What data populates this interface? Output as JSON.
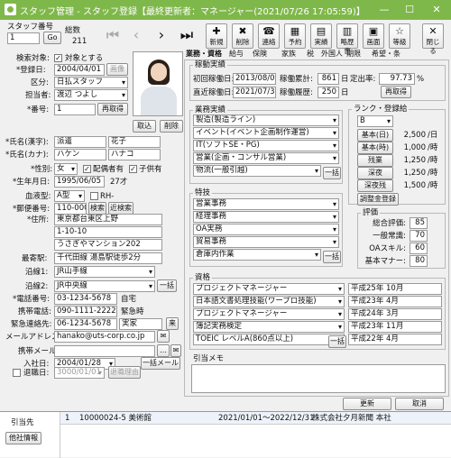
{
  "window": {
    "title": "スタッフ管理 - スタッフ登録【最終更新者：マネージャー(2021/07/26 17:05:59)】",
    "min": "—",
    "max": "☐",
    "close": "✕"
  },
  "search": {
    "label": "スタッフ番号",
    "value": "1",
    "go": "Go",
    "total_label": "総数",
    "total": "211"
  },
  "nav": {
    "first": "|◀",
    "prev": "◀",
    "next": "▶",
    "last": "▶|"
  },
  "toolbar": [
    {
      "icon": "new-icon",
      "glyph": "✚",
      "label": "新規"
    },
    {
      "icon": "delete-icon",
      "glyph": "✖",
      "label": "削除"
    },
    {
      "icon": "contact-icon",
      "glyph": "☎",
      "label": "連絡"
    },
    {
      "icon": "schedule-icon",
      "glyph": "▦",
      "label": "予約"
    },
    {
      "icon": "results-icon",
      "glyph": "▤",
      "label": "実績"
    },
    {
      "icon": "resume-icon",
      "glyph": "▥",
      "label": "略歴書"
    },
    {
      "icon": "screen-icon",
      "glyph": "▣",
      "label": "画面"
    },
    {
      "icon": "star-icon",
      "glyph": "☆",
      "label": "等級"
    },
    {
      "icon": "close-icon",
      "glyph": "✕",
      "label": "閉じる"
    }
  ],
  "form": {
    "search_target_label": "検索対象:",
    "search_target_check": "対象とする",
    "reg_date_label": "*登録日:",
    "reg_date": "2004/04/01",
    "reg_date_btn": "画像",
    "category_label": "区分:",
    "category": "日払スタッフ",
    "manager_label": "担当者:",
    "manager": "渡辺 つよし",
    "number_label": "*番号:",
    "number": "1",
    "renumber": "再取得",
    "import": "取込",
    "delete": "削除",
    "kanji_label": "*氏名(漢字):",
    "last_kanji": "派遣",
    "first_kanji": "花子",
    "kana_label": "*氏名(カナ):",
    "last_kana": "ハケン",
    "first_kana": "ハナコ",
    "gender_label": "*性別:",
    "gender": "女",
    "spouse": "配偶者有",
    "children": "子供有",
    "birth_label": "*生年月日:",
    "birth": "1995/06/05",
    "age": "27才",
    "blood_label": "血液型:",
    "blood": "A型",
    "rh": "RH-",
    "zip_label": "*郵便番号:",
    "zip": "110-0005",
    "zip_search": "検索",
    "zip_near": "近検索",
    "addr_label": "*住所:",
    "addr1": "東京都台東区上野",
    "addr2": "1-10-10",
    "addr3": "うさぎやマンション202",
    "station_label": "最寄駅:",
    "station": "千代田線 湯島駅徒歩2分",
    "line1_label": "沿線1:",
    "line1": "JR山手線",
    "line2_label": "沿線2:",
    "line2": "JR中央線",
    "line_all": "一括",
    "tel_label": "*電話番号:",
    "tel": "03-1234-5678",
    "tel_note": "自宅",
    "mobile_label": "携帯電話:",
    "mobile": "090-1111-2222",
    "mobile_note": "緊急時",
    "emerg_label": "緊急連絡先:",
    "emerg": "06-1234-5678",
    "emerg_note": "実家",
    "emerg_btn": "来",
    "mail_label": "メールアドレス:",
    "mail": "hanako@uts-corp.co.jp",
    "mmail_label": "携帯メール:",
    "mmail": "",
    "join_label": "入社日:",
    "join": "2004/01/28",
    "join_btn": "一括メール",
    "leave_label": "退職日:",
    "leave": "3000/01/01",
    "leave_reason": "退職理由"
  },
  "tabs": [
    "業務・資格",
    "給与",
    "保険",
    "家族",
    "税",
    "外国人",
    "期限",
    "希望・条"
  ],
  "work": {
    "title": "稼動実績",
    "first_label": "初回稼働日:",
    "first": "2013/08/01",
    "count_label": "稼働累計:",
    "count": "861",
    "count_unit": "日",
    "rate_label": "定出率:",
    "rate": "97.73",
    "rate_unit": "%",
    "last_label": "直近稼働日:",
    "last": "2021/07/30",
    "hist_label": "稼働履歴:",
    "hist": "250",
    "hist_unit": "日",
    "refresh": "再取得"
  },
  "job": {
    "title": "業務実績",
    "items": [
      "製造(製造ライン)",
      "イベント(イベント企画制作運営)",
      "IT(ソフトSE・PG)",
      "営業(企画・コンサル営業)",
      "物流(一般引越)"
    ],
    "all": "一括"
  },
  "rank": {
    "title": "ランク・登録給",
    "rank": "B",
    "rows": [
      {
        "label": "基本(日)",
        "value": "2,500",
        "unit": "/日"
      },
      {
        "label": "基本(時)",
        "value": "1,000",
        "unit": "/時"
      },
      {
        "label": "残業",
        "value": "1,250",
        "unit": "/時"
      },
      {
        "label": "深夜",
        "value": "1,250",
        "unit": "/時"
      },
      {
        "label": "深夜残",
        "value": "1,500",
        "unit": "/時"
      }
    ],
    "adjust": "調整金登録"
  },
  "skill": {
    "title": "特技",
    "items": [
      "営業事務",
      "経理事務",
      "OA実務",
      "貿易事務",
      "倉庫内作業"
    ],
    "all": "一括"
  },
  "eval": {
    "title": "評価",
    "rows": [
      {
        "label": "総合評価:",
        "value": "85"
      },
      {
        "label": "一般常識:",
        "value": "70"
      },
      {
        "label": "OAスキル:",
        "value": "60"
      },
      {
        "label": "基本マナー:",
        "value": "80"
      }
    ]
  },
  "qual": {
    "title": "資格",
    "items": [
      {
        "name": "プロジェクトマネージャー",
        "date": "平成25年 10月"
      },
      {
        "name": "日本語文書処理技能(ワープロ技能)",
        "date": "平成23年 4月"
      },
      {
        "name": "プロジェクトマネージャー",
        "date": "平成24年 3月"
      },
      {
        "name": "簿記実務検定",
        "date": "平成23年 11月"
      },
      {
        "name": "TOEIC レベルA(860点以上)",
        "date": "平成22年 4月"
      }
    ],
    "all": "一括"
  },
  "memo": {
    "title": "引当メモ"
  },
  "footer": {
    "update": "更新",
    "cancel": "取消"
  },
  "alloc": {
    "label": "引当先",
    "btn": "他社情報",
    "row": {
      "no": "1",
      "code": "10000024-5 美術館",
      "period": "2021/01/01～2022/12/31",
      "company": "株式会社夕月新聞 本社"
    }
  }
}
